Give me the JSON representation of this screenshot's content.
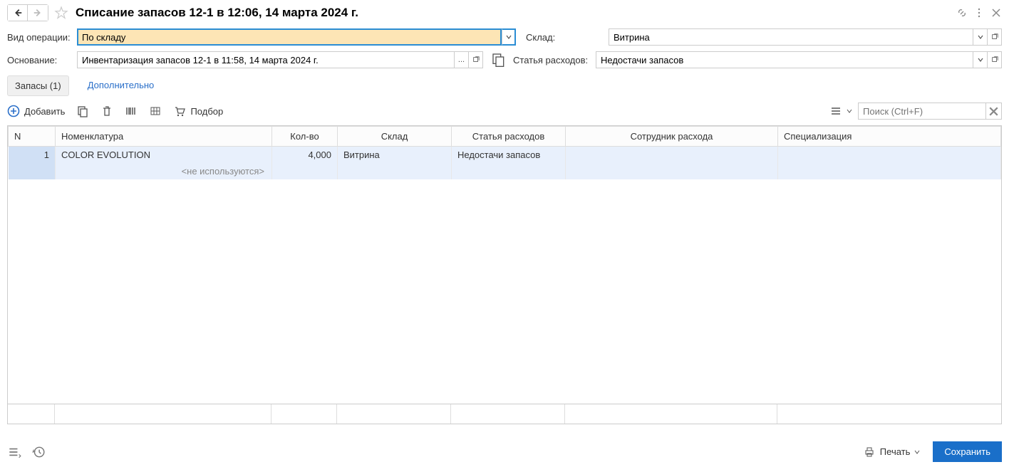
{
  "header": {
    "title": "Списание запасов 12-1 в 12:06, 14 марта 2024 г."
  },
  "form": {
    "operation_label": "Вид операции:",
    "operation_value": "По складу",
    "warehouse_label": "Склад:",
    "warehouse_value": "Витрина",
    "basis_label": "Основание:",
    "basis_value": "Инвентаризация запасов 12-1 в 11:58, 14 марта 2024 г.",
    "expense_label": "Статья расходов:",
    "expense_value": "Недостачи запасов"
  },
  "tabs": {
    "stock": "Запасы (1)",
    "additional": "Дополнительно"
  },
  "toolbar": {
    "add": "Добавить",
    "select": "Подбор",
    "search_placeholder": "Поиск (Ctrl+F)"
  },
  "table": {
    "headers": {
      "n": "N",
      "nomenclature": "Номенклатура",
      "qty": "Кол-во",
      "warehouse": "Склад",
      "expense": "Статья расходов",
      "employee": "Сотрудник расхода",
      "specialization": "Специализация"
    },
    "row": {
      "n": "1",
      "nomenclature": "COLOR EVOLUTION",
      "qty": "4,000",
      "warehouse": "Витрина",
      "expense": "Недостачи запасов",
      "employee": "",
      "specialization": "",
      "subtext": "<не используются>"
    }
  },
  "footer": {
    "print": "Печать",
    "save": "Сохранить"
  }
}
